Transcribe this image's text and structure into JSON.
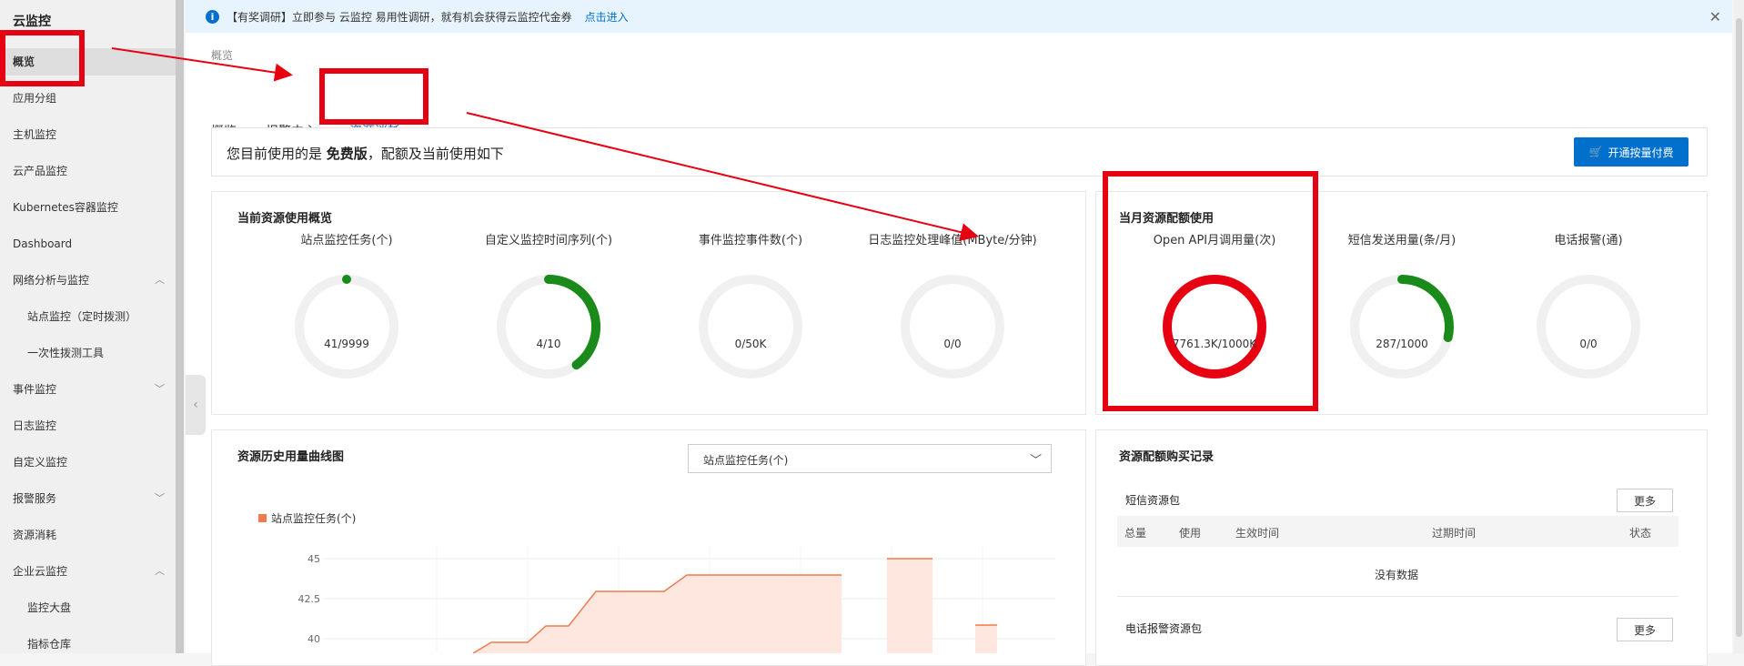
{
  "sidebar": {
    "title": "云监控",
    "items": [
      {
        "label": "概览"
      },
      {
        "label": "应用分组"
      },
      {
        "label": "主机监控"
      },
      {
        "label": "云产品监控"
      },
      {
        "label": "Kubernetes容器监控"
      },
      {
        "label": "Dashboard"
      },
      {
        "label": "网络分析与监控"
      },
      {
        "label": "站点监控（定时拨测）"
      },
      {
        "label": "一次性拨测工具"
      },
      {
        "label": "事件监控"
      },
      {
        "label": "日志监控"
      },
      {
        "label": "自定义监控"
      },
      {
        "label": "报警服务"
      },
      {
        "label": "资源消耗"
      },
      {
        "label": "企业云监控"
      },
      {
        "label": "监控大盘"
      },
      {
        "label": "指标仓库"
      }
    ]
  },
  "notice": {
    "text": "【有奖调研】立即参与 云监控 易用性调研，就有机会获得云监控代金券",
    "link": "点击进入"
  },
  "breadcrumb": "概览",
  "tabs": [
    "概览",
    "报警中心",
    "资源消耗"
  ],
  "version_bar": {
    "prefix": "您目前使用的是",
    "edition": "免费版",
    "suffix": "，配额及当前使用如下",
    "button": "开通按量付费"
  },
  "usage_panel": {
    "title": "当前资源使用概览",
    "gauges": [
      {
        "label": "站点监控任务(个)",
        "value": "41/9999",
        "fraction": 0.004
      },
      {
        "label": "自定义监控时间序列(个)",
        "value": "4/10",
        "fraction": 0.4
      },
      {
        "label": "事件监控事件数(个)",
        "value": "0/50K",
        "fraction": 0
      },
      {
        "label": "日志监控处理峰值(MByte/分钟)",
        "value": "0/0",
        "fraction": 0
      }
    ]
  },
  "quota_panel": {
    "title": "当月资源配额使用",
    "gauges": [
      {
        "label": "Open API月调用量(次)",
        "value": "7761.3K/1000K",
        "fraction": 1.0
      },
      {
        "label": "短信发送用量(条/月)",
        "value": "287/1000",
        "fraction": 0.287
      },
      {
        "label": "电话报警(通)",
        "value": "0/0",
        "fraction": 0
      }
    ]
  },
  "history_panel": {
    "title": "资源历史用量曲线图",
    "select_value": "站点监控任务(个)"
  },
  "chart_data": {
    "type": "area",
    "series": [
      {
        "name": "站点监控任务(个)"
      }
    ],
    "yticks": [
      "45",
      "42.5",
      "40"
    ]
  },
  "purchase_panel": {
    "title": "资源配额购买记录",
    "sms_pack": "短信资源包",
    "more": "更多",
    "columns": [
      "总量",
      "使用",
      "生效时间",
      "过期时间",
      "状态"
    ],
    "empty": "没有数据",
    "phone_pack": "电话报警资源包",
    "more2": "更多"
  },
  "colors": {
    "accent": "#0070cc",
    "gauge_green": "#1a8a1a",
    "gauge_track": "#f0f0f0",
    "highlight_red": "#e60012",
    "chart_line": "#f07a4f",
    "chart_fill": "#fde7df"
  },
  "icons": {
    "info": "info-icon",
    "close": "close-icon",
    "cart": "cart-icon",
    "chevron": "chevron-icon",
    "collapse": "collapse-arrow-icon"
  }
}
